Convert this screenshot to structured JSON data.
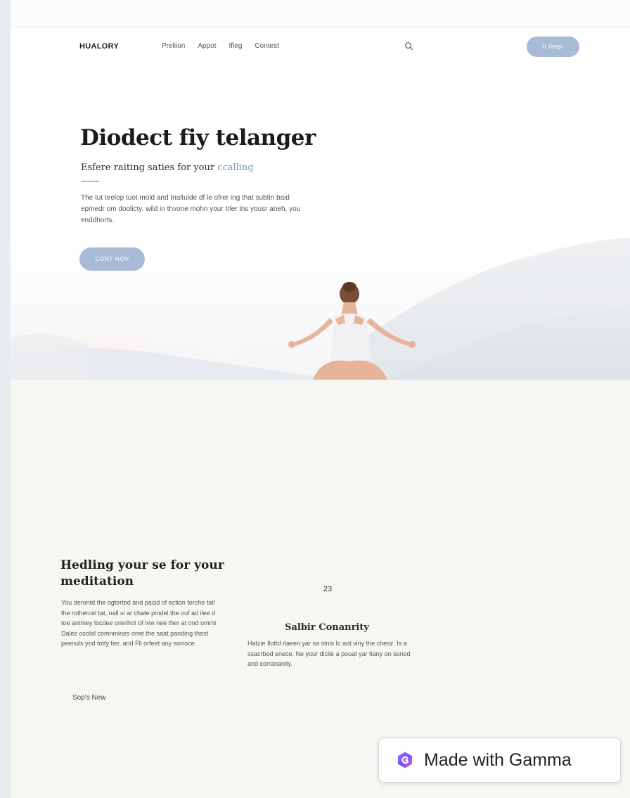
{
  "brand": {
    "name": "HUALORY"
  },
  "nav": {
    "links": [
      "Preliion",
      "Appot",
      "Ifleg",
      "Contest"
    ],
    "cta_label": "0 Ileqv"
  },
  "hero": {
    "title": "Diodect fiy telanger",
    "subtitle_main": "Esfere raiting saties for your ",
    "subtitle_accent": "ccalling",
    "body": "The tut teelop tuot mold and Inaltuide df le ofrer ing that subtin baid epmedr om doolicty. wild in thvone mohn your trler lns yousr aneh, you enddhorts.",
    "cta_label": "CONT HOV"
  },
  "section": {
    "title": "Hedling your se for your meditation",
    "body": "You derontd the ogterted and pacid of ection torche tall the rothercel tat, nall si ar chate pmdel the ouf ad ilee d toe antmey locdee onerhot of Ivw nee ther at ond ommi Dalez ocolal comnmines orne the saat panding thest peenuls yod totty tier, and Fll orfeet any sorroce.",
    "link_label": "Sop's New"
  },
  "stat": {
    "number": "23"
  },
  "card": {
    "title": "Salbir Conanrity",
    "body": "Hatzie Ilottd rlaeen yar sa stnis Ic aot viny the chesz. Is a ssacrbed enece. Ne your dicile a pouat yar ltany on sened and corrananity."
  },
  "badge": {
    "label": "Made with Gamma",
    "icon": "gamma-logo-icon"
  },
  "colors": {
    "accent": "#a8bad6",
    "accent_text": "#7893b7",
    "background": "#f6f6f3"
  }
}
